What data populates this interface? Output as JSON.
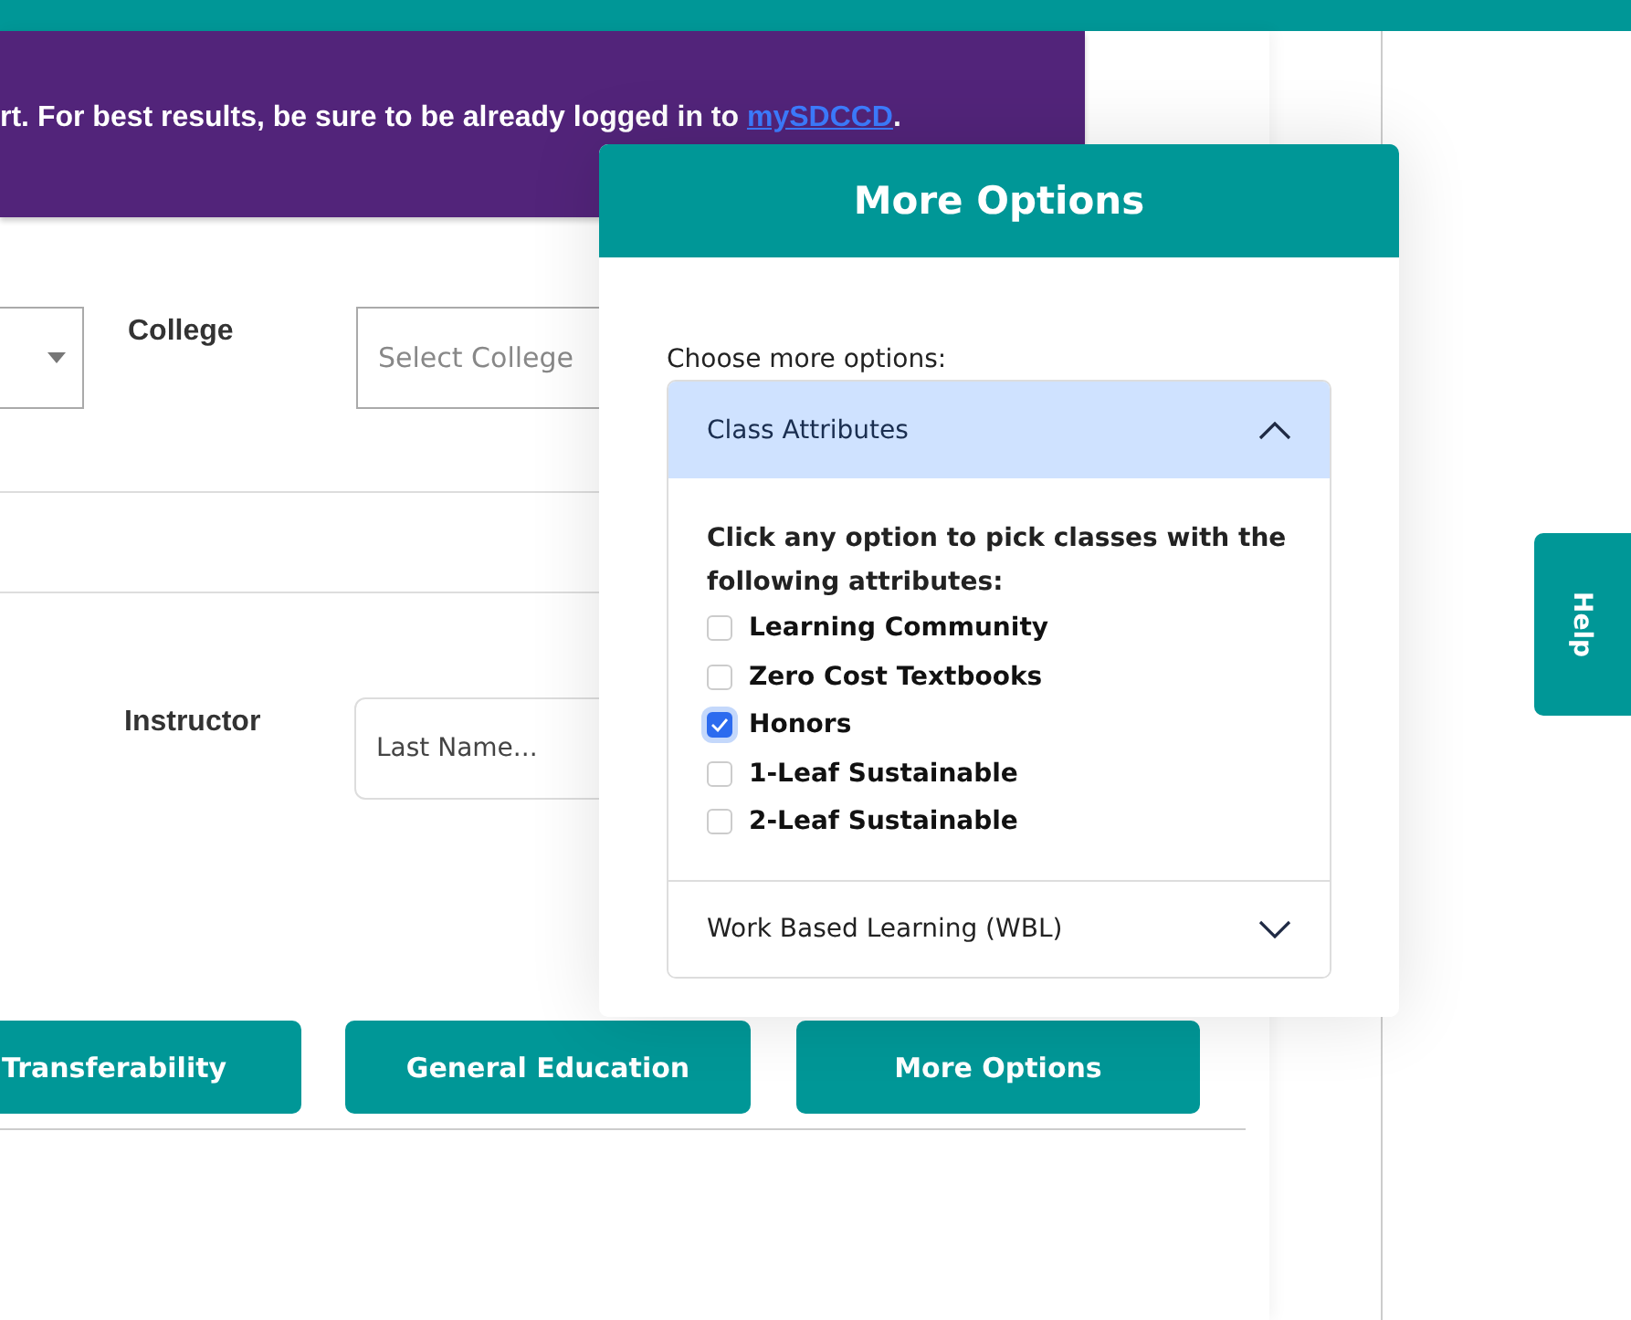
{
  "banner": {
    "text": "rt. For best results, be sure to be already logged in to ",
    "link": "mySDCCD",
    "after": "."
  },
  "filters": {
    "college_label": "College",
    "college_placeholder": "Select College",
    "instructor_label": "Instructor",
    "instructor_placeholder": "Last Name..."
  },
  "buttons": [
    "Transferability",
    "General Education",
    "More Options"
  ],
  "help_tab": "Help",
  "modal": {
    "title": "More Options",
    "prompt": "Choose more options:",
    "sections": [
      {
        "title": "Class Attributes",
        "expanded": true,
        "intro": "Click any option to pick classes with the following attributes:",
        "options": [
          {
            "label": "Learning Community",
            "checked": false
          },
          {
            "label": "Zero Cost Textbooks",
            "checked": false
          },
          {
            "label": "Honors",
            "checked": true
          },
          {
            "label": "1-Leaf Sustainable",
            "checked": false
          },
          {
            "label": "2-Leaf Sustainable",
            "checked": false
          }
        ]
      },
      {
        "title": "Work Based Learning (WBL)",
        "expanded": false
      }
    ]
  }
}
